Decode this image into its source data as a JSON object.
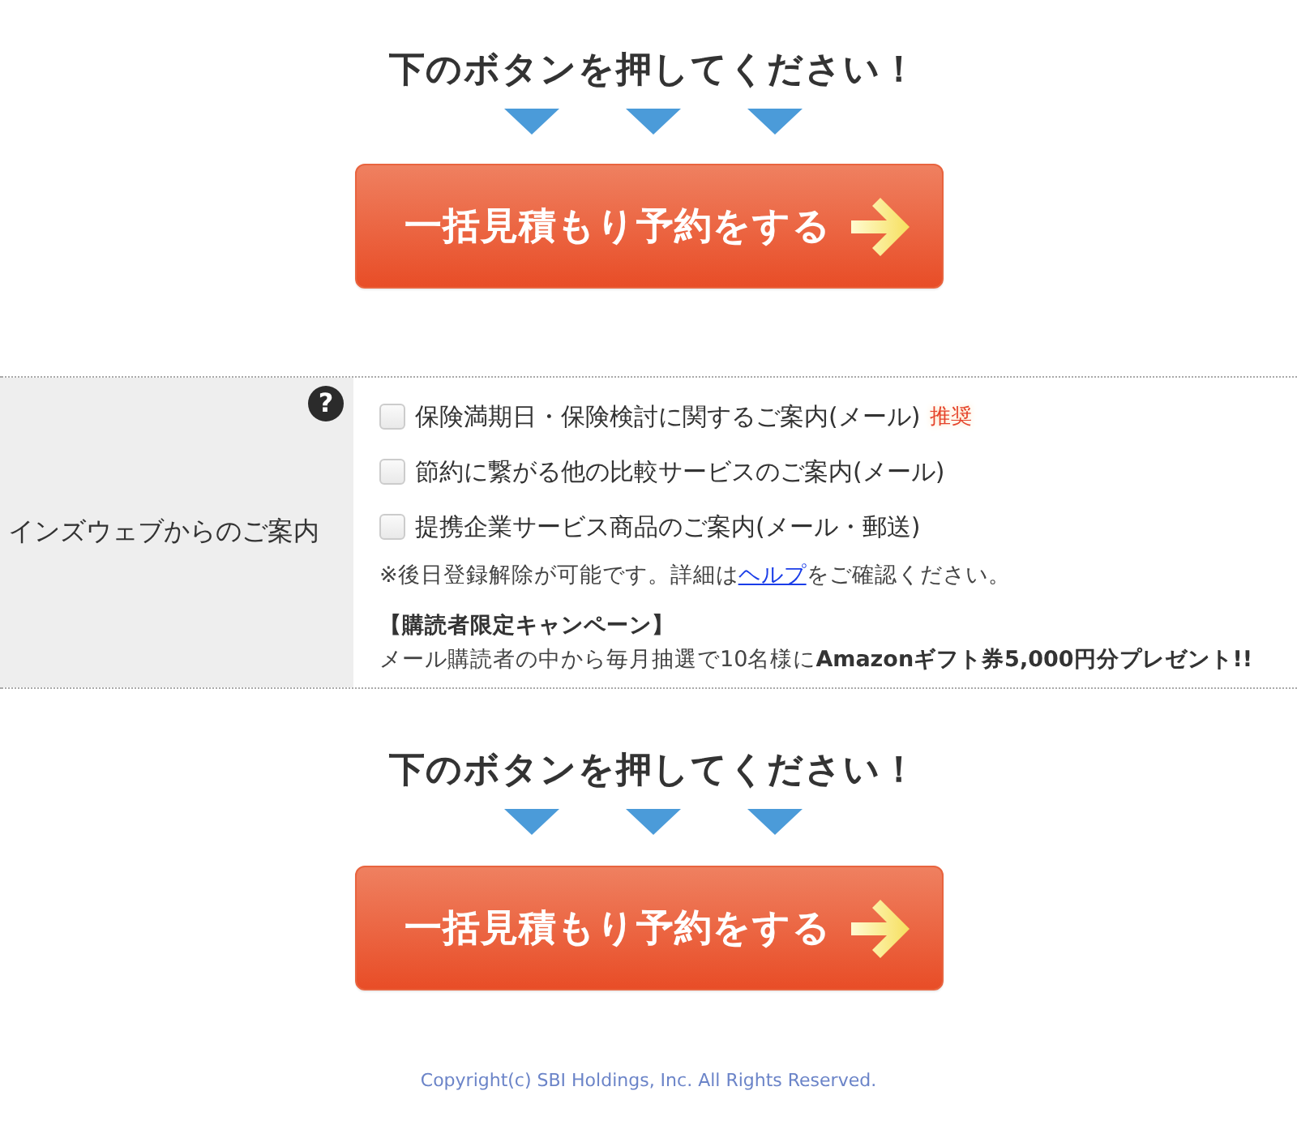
{
  "top_cta": {
    "prompt": "下のボタンを押してください！",
    "button": "一括見積もり予約をする"
  },
  "newsletter": {
    "label": "インズウェブからのご案内",
    "help_icon": "?",
    "options": [
      {
        "label": "保険満期日・保険検討に関するご案内(メール)",
        "checked": false,
        "badge": "推奨"
      },
      {
        "label": "節約に繋がる他の比較サービスのご案内(メール)",
        "checked": false
      },
      {
        "label": "提携企業サービス商品のご案内(メール・郵送)",
        "checked": false
      }
    ],
    "note": {
      "before": "※後日登録解除が可能です。詳細は",
      "link": "ヘルプ",
      "after": "をご確認ください。"
    },
    "campaign": {
      "title": "【購読者限定キャンペーン】",
      "text": "メール購読者の中から毎月抽選で10名様に**Amazonギフト券5,000円分プレゼント!!**"
    }
  },
  "bottom_cta": {
    "prompt": "下のボタンを押してください！",
    "button": "一括見積もり予約をする"
  },
  "footer": {
    "copyright": "Copyright(c) SBI Holdings, Inc. All Rights Reserved."
  }
}
